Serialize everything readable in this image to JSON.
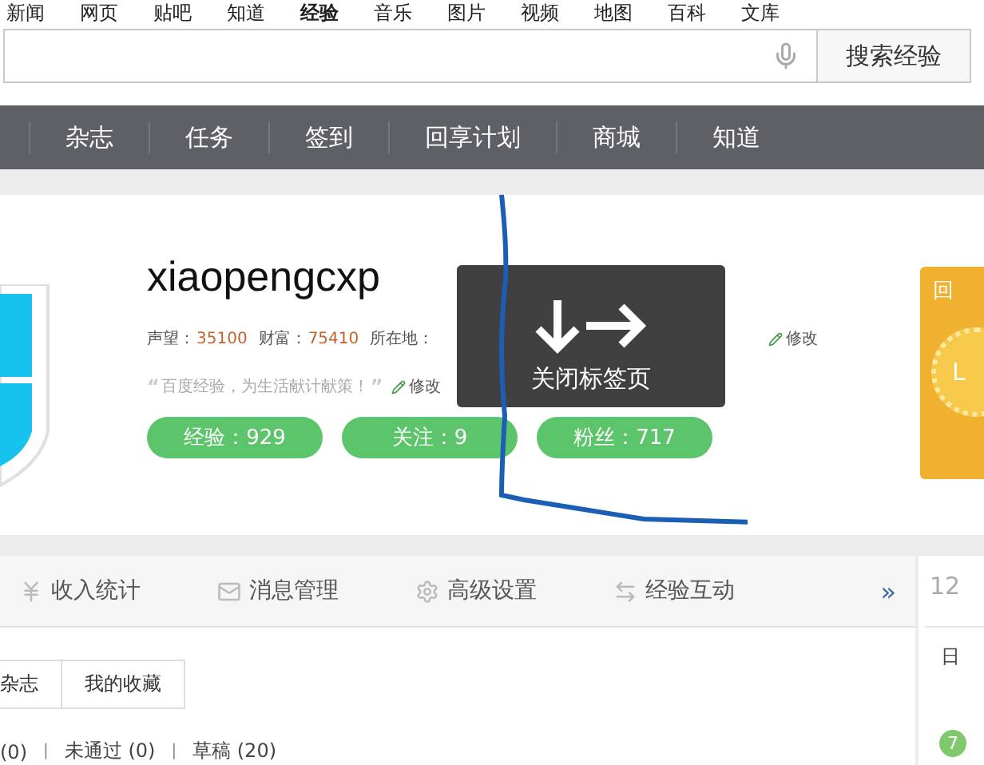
{
  "top_links": [
    {
      "label": "新闻",
      "selected": false
    },
    {
      "label": "网页",
      "selected": false
    },
    {
      "label": "贴吧",
      "selected": false
    },
    {
      "label": "知道",
      "selected": false
    },
    {
      "label": "经验",
      "selected": true
    },
    {
      "label": "音乐",
      "selected": false
    },
    {
      "label": "图片",
      "selected": false
    },
    {
      "label": "视频",
      "selected": false
    },
    {
      "label": "地图",
      "selected": false
    },
    {
      "label": "百科",
      "selected": false
    },
    {
      "label": "文库",
      "selected": false
    }
  ],
  "search": {
    "button": "搜索经验"
  },
  "nav": [
    "杂志",
    "任务",
    "签到",
    "回享计划",
    "商城",
    "知道"
  ],
  "profile": {
    "name": "xiaopengcxp",
    "stats": [
      {
        "label": "声望：",
        "value": "35100"
      },
      {
        "label": "财富：",
        "value": "75410"
      }
    ],
    "location_label": "所在地：",
    "location_edit": "修改",
    "open_quote": "“",
    "motto": "百度经验，为生活献计献策！",
    "close_quote": "”",
    "motto_edit": "修改",
    "pills": [
      "经验：929",
      "关注：9",
      "粉丝：717"
    ],
    "badge_title": "回",
    "badge_letter": "L"
  },
  "tooltip": {
    "text": "关闭标签页"
  },
  "tabs": [
    {
      "label": "收入统计",
      "kind": "income"
    },
    {
      "label": "消息管理",
      "kind": "messages"
    },
    {
      "label": "高级设置",
      "kind": "settings"
    },
    {
      "label": "经验互动",
      "kind": "interaction"
    }
  ],
  "more": "»",
  "subtabs": [
    {
      "label": "杂志",
      "selected": false
    },
    {
      "label": "我的收藏",
      "selected": false
    }
  ],
  "status_items": [
    "(0)",
    "未通过 (0)",
    "草稿 (20)"
  ],
  "status_separators": [
    "|",
    "|"
  ],
  "calendar": {
    "month": "12",
    "weekday": "日",
    "day": "7"
  }
}
